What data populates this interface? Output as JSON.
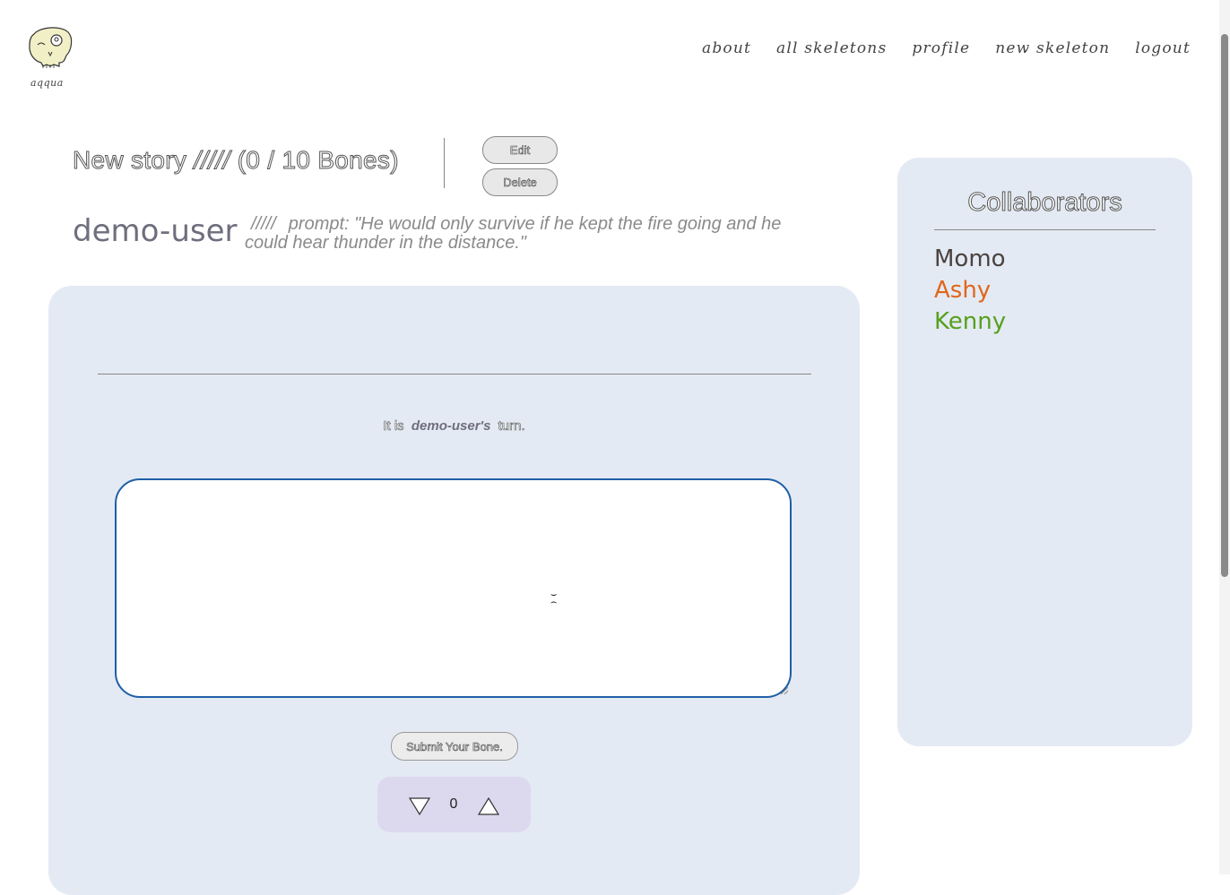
{
  "header": {
    "logo_text": "aqqua",
    "nav": [
      "about",
      "all skeletons",
      "profile",
      "new skeleton",
      "logout"
    ]
  },
  "story": {
    "title": "New story",
    "title_slashes": "/////",
    "bone_count": "(0 / 10 Bones)",
    "edit_label": "Edit",
    "delete_label": "Delete",
    "author": "demo-user",
    "prompt_slashes": "/////",
    "prompt": "prompt: \"He would only survive if he kept the fire going and he could hear thunder in the distance.\""
  },
  "turn": {
    "prefix": "It is",
    "user": "demo-user's",
    "suffix": "turn."
  },
  "editor": {
    "value": "",
    "submit_label": "Submit Your Bone."
  },
  "vote": {
    "count": "0"
  },
  "collaborators": {
    "heading": "Collaborators",
    "names": [
      {
        "name": "Momo",
        "color": "#4a4340"
      },
      {
        "name": "Ashy",
        "color": "#e0661c"
      },
      {
        "name": "Kenny",
        "color": "#56a01e"
      }
    ]
  },
  "colors": {
    "panel_bg": "#e4eaf3",
    "vote_bg": "#dcd8ee",
    "input_border": "#1f5fa8"
  }
}
